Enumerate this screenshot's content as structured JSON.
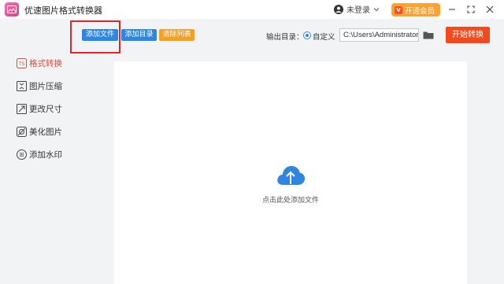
{
  "app": {
    "title": "优速图片格式转换器"
  },
  "user": {
    "login_label": "未登录",
    "vip_label": "开通会员",
    "vip_icon_char": "V"
  },
  "window_controls": [
    "minimize",
    "maximize",
    "close"
  ],
  "sidebar": {
    "items": [
      {
        "label": "格式转换",
        "icon": "format-convert-icon",
        "active": true
      },
      {
        "label": "图片压缩",
        "icon": "compress-icon",
        "active": false
      },
      {
        "label": "更改尺寸",
        "icon": "resize-icon",
        "active": false
      },
      {
        "label": "美化图片",
        "icon": "beautify-icon",
        "active": false
      },
      {
        "label": "添加水印",
        "icon": "watermark-icon",
        "active": false
      }
    ]
  },
  "toolbar": {
    "add_file": "添加文件",
    "add_dir": "添加目录",
    "clear_list": "清除列表",
    "output_label": "输出目录：",
    "custom_label": "自定义",
    "output_path": "C:\\Users\\Administrator\\",
    "start_label": "开始转换"
  },
  "drop": {
    "hint": "点击此处添加文件"
  },
  "colors": {
    "accent_blue": "#2f86e2",
    "accent_orange": "#f3a024",
    "start_red": "#f24a1d",
    "active_red": "#e24a3a",
    "highlight_red": "#e0262b"
  }
}
